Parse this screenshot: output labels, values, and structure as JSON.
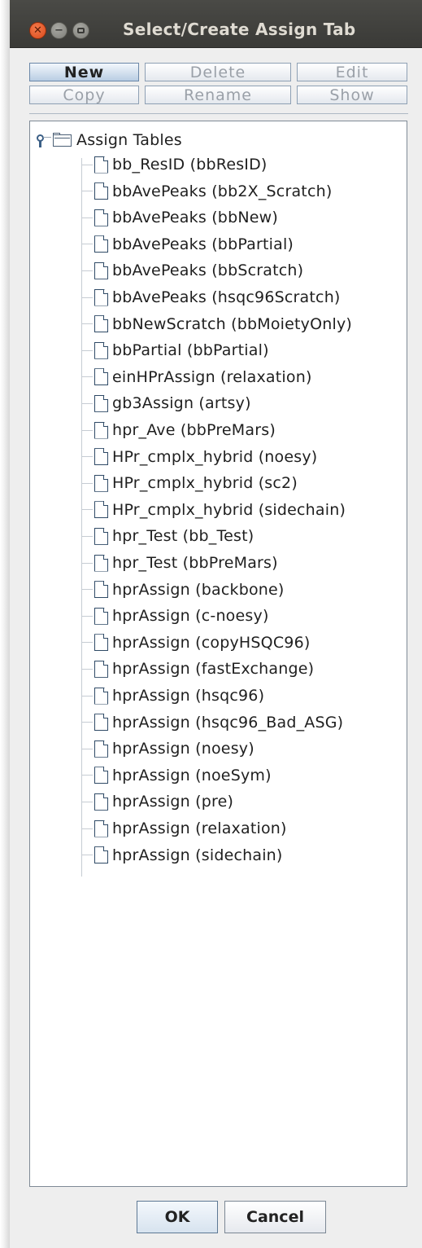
{
  "window": {
    "title": "Select/Create Assign Tab"
  },
  "toolbar": {
    "new_label": "New",
    "delete_label": "Delete",
    "edit_label": "Edit",
    "copy_label": "Copy",
    "rename_label": "Rename",
    "show_label": "Show"
  },
  "tree": {
    "root_label": "Assign Tables",
    "items": [
      "bb_ResID (bbResID)",
      "bbAvePeaks (bb2X_Scratch)",
      "bbAvePeaks (bbNew)",
      "bbAvePeaks (bbPartial)",
      "bbAvePeaks (bbScratch)",
      "bbAvePeaks (hsqc96Scratch)",
      "bbNewScratch (bbMoietyOnly)",
      "bbPartial (bbPartial)",
      "einHPrAssign (relaxation)",
      "gb3Assign (artsy)",
      "hpr_Ave (bbPreMars)",
      "HPr_cmplx_hybrid (noesy)",
      "HPr_cmplx_hybrid (sc2)",
      "HPr_cmplx_hybrid (sidechain)",
      "hpr_Test (bb_Test)",
      "hpr_Test (bbPreMars)",
      "hprAssign (backbone)",
      "hprAssign (c-noesy)",
      "hprAssign (copyHSQC96)",
      "hprAssign (fastExchange)",
      "hprAssign (hsqc96)",
      "hprAssign (hsqc96_Bad_ASG)",
      "hprAssign (noesy)",
      "hprAssign (noeSym)",
      "hprAssign (pre)",
      "hprAssign (relaxation)",
      "hprAssign (sidechain)"
    ]
  },
  "footer": {
    "ok_label": "OK",
    "cancel_label": "Cancel"
  }
}
